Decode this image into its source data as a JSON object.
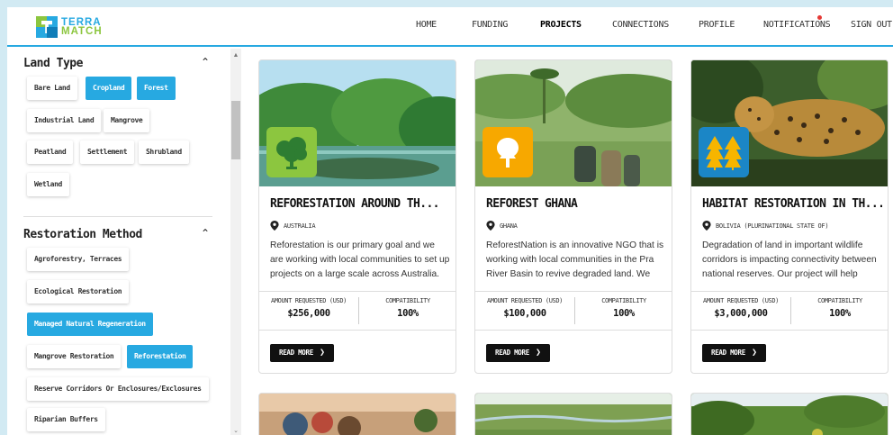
{
  "logo": {
    "line1": "TERRA",
    "line2": "MATCH"
  },
  "nav": {
    "home": "HOME",
    "funding": "FUNDING",
    "projects": "PROJECTS",
    "connections": "CONNECTIONS",
    "profile": "PROFILE",
    "notifications": "NOTIFICATIONS",
    "signout": "SIGN OUT"
  },
  "filters": {
    "land_type": {
      "title": "Land Type",
      "chips": [
        {
          "label": "Bare Land",
          "selected": false
        },
        {
          "label": "Cropland",
          "selected": true
        },
        {
          "label": "Forest",
          "selected": true
        },
        {
          "label": "Industrial Land",
          "selected": false
        },
        {
          "label": "Mangrove",
          "selected": false
        },
        {
          "label": "Peatland",
          "selected": false
        },
        {
          "label": "Settlement",
          "selected": false
        },
        {
          "label": "Shrubland",
          "selected": false
        },
        {
          "label": "Wetland",
          "selected": false
        }
      ]
    },
    "restoration_method": {
      "title": "Restoration Method",
      "chips": [
        {
          "label": "Agroforestry, Terraces",
          "selected": false
        },
        {
          "label": "Ecological Restoration",
          "selected": false
        },
        {
          "label": "Managed Natural Regeneration",
          "selected": true
        },
        {
          "label": "Mangrove Restoration",
          "selected": false
        },
        {
          "label": "Reforestation",
          "selected": true
        },
        {
          "label": "Reserve Corridors Or Enclosures/Exclosures",
          "selected": false
        },
        {
          "label": "Riparian Buffers",
          "selected": false
        }
      ]
    }
  },
  "cards": [
    {
      "title": "REFORESTATION AROUND TH...",
      "location": "AUSTRALIA",
      "description": "Reforestation is our primary goal and we are working with local communities to set up projects on a large scale across Australia.",
      "amount_label": "AMOUNT REQUESTED (USD)",
      "amount": "$256,000",
      "compat_label": "COMPATIBILITY",
      "compat": "100%",
      "button": "READ MORE",
      "badge_color": "#8cc63f",
      "badge_icon": "tree-icon"
    },
    {
      "title": "REFOREST GHANA",
      "location": "GHANA",
      "description": "ReforestNation is an innovative NGO that is working with local communities in the Pra River Basin to revive degraded land. We have",
      "amount_label": "AMOUNT REQUESTED (USD)",
      "amount": "$100,000",
      "compat_label": "COMPATIBILITY",
      "compat": "100%",
      "button": "READ MORE",
      "badge_color": "#f7a800",
      "badge_icon": "leafy-tree-icon"
    },
    {
      "title": "HABITAT RESTORATION IN TH...",
      "location": "BOLIVIA (PLURINATIONAL STATE OF)",
      "description": "Degradation of land in important wildlife corridors is impacting connectivity between national reserves. Our project will help restore",
      "amount_label": "AMOUNT REQUESTED (USD)",
      "amount": "$3,000,000",
      "compat_label": "COMPATIBILITY",
      "compat": "100%",
      "button": "READ MORE",
      "badge_color": "#1b86c6",
      "badge_icon": "pine-trees-icon"
    }
  ]
}
